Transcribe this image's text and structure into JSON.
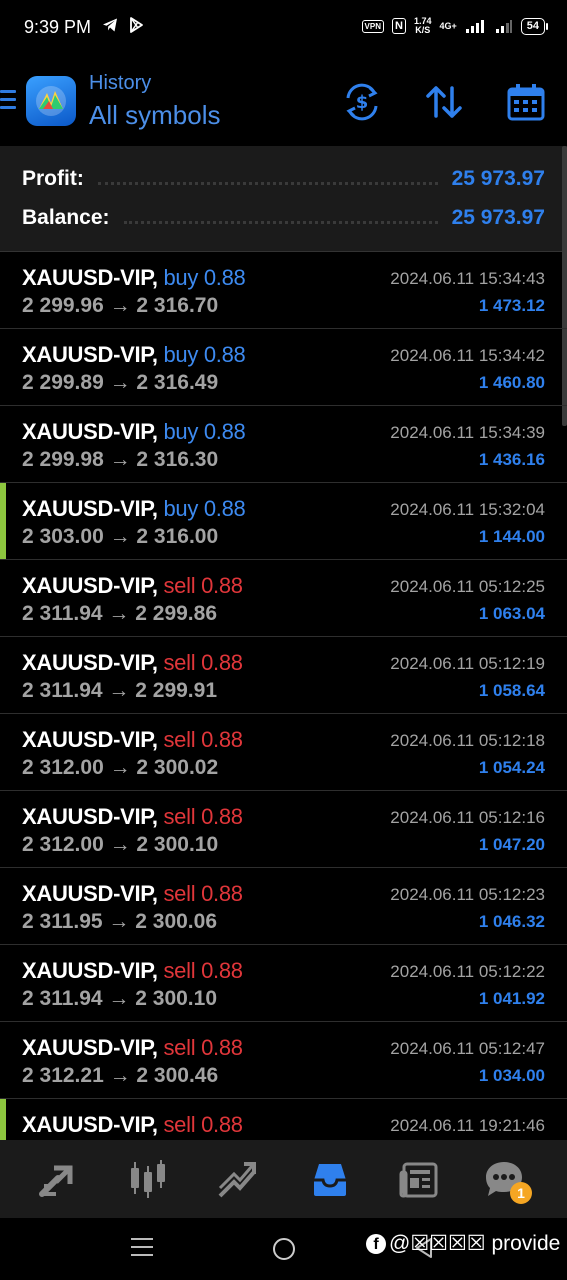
{
  "status_bar": {
    "time": "9:39 PM",
    "vpn": "VPN",
    "nfc": "N",
    "speed_value": "1.74",
    "speed_unit": "K/S",
    "network": "4G+",
    "battery": "54"
  },
  "header": {
    "subtitle": "History",
    "title": "All symbols"
  },
  "summary": {
    "profit_label": "Profit:",
    "profit_value": "25 973.97",
    "balance_label": "Balance:",
    "balance_value": "25 973.97"
  },
  "deals": [
    {
      "symbol": "XAUUSD-VIP,",
      "side": "buy 0.88",
      "side_type": "buy",
      "prices": "2 299.96 → 2 316.70",
      "time": "2024.06.11 15:34:43",
      "profit": "1 473.12",
      "marked": false
    },
    {
      "symbol": "XAUUSD-VIP,",
      "side": "buy 0.88",
      "side_type": "buy",
      "prices": "2 299.89 → 2 316.49",
      "time": "2024.06.11 15:34:42",
      "profit": "1 460.80",
      "marked": false
    },
    {
      "symbol": "XAUUSD-VIP,",
      "side": "buy 0.88",
      "side_type": "buy",
      "prices": "2 299.98 → 2 316.30",
      "time": "2024.06.11 15:34:39",
      "profit": "1 436.16",
      "marked": false
    },
    {
      "symbol": "XAUUSD-VIP,",
      "side": "buy 0.88",
      "side_type": "buy",
      "prices": "2 303.00 → 2 316.00",
      "time": "2024.06.11 15:32:04",
      "profit": "1 144.00",
      "marked": true
    },
    {
      "symbol": "XAUUSD-VIP,",
      "side": "sell 0.88",
      "side_type": "sell",
      "prices": "2 311.94 → 2 299.86",
      "time": "2024.06.11 05:12:25",
      "profit": "1 063.04",
      "marked": false
    },
    {
      "symbol": "XAUUSD-VIP,",
      "side": "sell 0.88",
      "side_type": "sell",
      "prices": "2 311.94 → 2 299.91",
      "time": "2024.06.11 05:12:19",
      "profit": "1 058.64",
      "marked": false
    },
    {
      "symbol": "XAUUSD-VIP,",
      "side": "sell 0.88",
      "side_type": "sell",
      "prices": "2 312.00 → 2 300.02",
      "time": "2024.06.11 05:12:18",
      "profit": "1 054.24",
      "marked": false
    },
    {
      "symbol": "XAUUSD-VIP,",
      "side": "sell 0.88",
      "side_type": "sell",
      "prices": "2 312.00 → 2 300.10",
      "time": "2024.06.11 05:12:16",
      "profit": "1 047.20",
      "marked": false
    },
    {
      "symbol": "XAUUSD-VIP,",
      "side": "sell 0.88",
      "side_type": "sell",
      "prices": "2 311.95 → 2 300.06",
      "time": "2024.06.11 05:12:23",
      "profit": "1 046.32",
      "marked": false
    },
    {
      "symbol": "XAUUSD-VIP,",
      "side": "sell 0.88",
      "side_type": "sell",
      "prices": "2 311.94 → 2 300.10",
      "time": "2024.06.11 05:12:22",
      "profit": "1 041.92",
      "marked": false
    },
    {
      "symbol": "XAUUSD-VIP,",
      "side": "sell 0.88",
      "side_type": "sell",
      "prices": "2 312.21 → 2 300.46",
      "time": "2024.06.11 05:12:47",
      "profit": "1 034.00",
      "marked": false
    },
    {
      "symbol": "XAUUSD-VIP,",
      "side": "sell 0.88",
      "side_type": "sell",
      "prices": "",
      "time": "2024.06.11 19:21:46",
      "profit": "",
      "marked": true
    }
  ],
  "tabs": [
    {
      "icon": "quotes-icon",
      "active": false
    },
    {
      "icon": "chart-icon",
      "active": false
    },
    {
      "icon": "trade-icon",
      "active": false
    },
    {
      "icon": "history-icon",
      "active": true
    },
    {
      "icon": "news-icon",
      "active": false
    },
    {
      "icon": "messages-icon",
      "active": false,
      "badge": "1"
    }
  ],
  "watermark": {
    "fb": "f",
    "text": "@☒☒☒☒ provide"
  },
  "colors": {
    "accent": "#2f80ed",
    "buy": "#3d8af0",
    "sell": "#e0363a",
    "marker": "#8dc63f",
    "badge": "#f5a623"
  }
}
